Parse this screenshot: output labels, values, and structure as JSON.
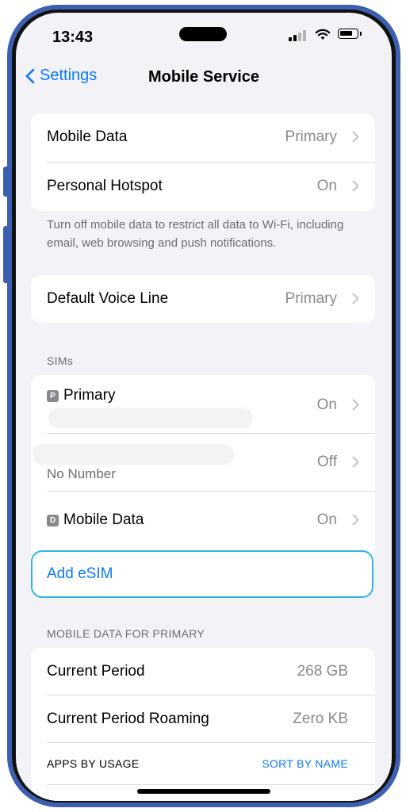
{
  "status_bar": {
    "time": "13:43"
  },
  "nav": {
    "back_label": "Settings",
    "title": "Mobile Service"
  },
  "group1": {
    "rows": [
      {
        "label": "Mobile Data",
        "value": "Primary"
      },
      {
        "label": "Personal Hotspot",
        "value": "On"
      }
    ],
    "footer": "Turn off mobile data to restrict all data to Wi-Fi, including email, web browsing and push notifications."
  },
  "group2": {
    "rows": [
      {
        "label": "Default Voice Line",
        "value": "Primary"
      }
    ]
  },
  "sims": {
    "header": "SIMs",
    "rows": [
      {
        "badge": "P",
        "label": "Primary",
        "value": "On"
      },
      {
        "label": "No Number",
        "value": "Off"
      },
      {
        "badge": "D",
        "label": "Mobile Data",
        "value": "On"
      }
    ],
    "add_esim": "Add eSIM"
  },
  "usage": {
    "header": "MOBILE DATA FOR PRIMARY",
    "rows": [
      {
        "label": "Current Period",
        "value": "268 GB"
      },
      {
        "label": "Current Period Roaming",
        "value": "Zero KB"
      }
    ],
    "apps_by_usage": "APPS BY USAGE",
    "sort_by_name": "SORT BY NAME"
  },
  "colors": {
    "accent": "#0a7aff",
    "frame": "#3d5fb0",
    "highlight": "#2fb6e6"
  }
}
